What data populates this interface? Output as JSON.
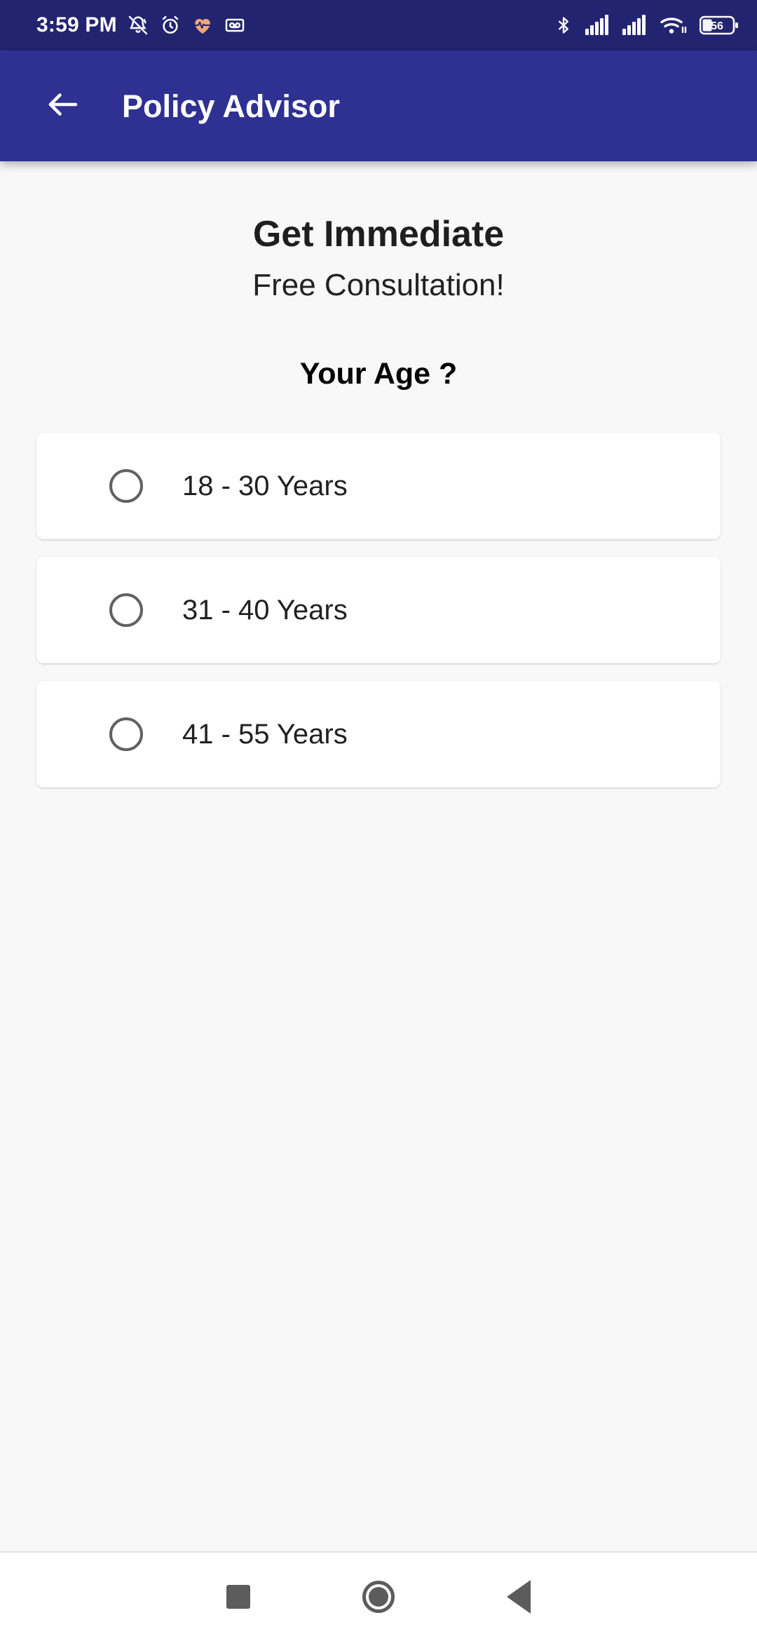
{
  "status_bar": {
    "time": "3:59 PM",
    "battery_level": "56",
    "left_icons": [
      {
        "name": "bell-off-icon"
      },
      {
        "name": "alarm-clock-icon"
      },
      {
        "name": "heart-pulse-icon"
      },
      {
        "name": "voicemail-icon"
      }
    ],
    "right_icons": [
      {
        "name": "bluetooth-icon"
      },
      {
        "name": "signal-bars-sim1-icon"
      },
      {
        "name": "signal-bars-sim2-icon"
      },
      {
        "name": "wifi-icon"
      },
      {
        "name": "battery-icon"
      }
    ],
    "colors": {
      "background": "#232470",
      "foreground": "#FFFFFF",
      "heart": "#F0A878"
    }
  },
  "app_bar": {
    "title": "Policy Advisor",
    "back_icon": "arrow-left-icon",
    "colors": {
      "background": "#2E3192",
      "foreground": "#FFFFFF"
    }
  },
  "main": {
    "headline": "Get Immediate",
    "subheadline": "Free Consultation!",
    "question": "Your Age ?",
    "options": [
      {
        "label": "18 - 30 Years",
        "selected": false
      },
      {
        "label": "31 - 40 Years",
        "selected": false
      },
      {
        "label": "41 - 55 Years",
        "selected": false
      }
    ],
    "colors": {
      "background": "#F8F8F8",
      "card": "#FFFFFF",
      "text": "#212121",
      "radio": "#616161"
    }
  },
  "nav_bar": {
    "buttons": [
      {
        "name": "recents-button",
        "icon": "square-icon"
      },
      {
        "name": "home-button",
        "icon": "circle-icon"
      },
      {
        "name": "back-button",
        "icon": "triangle-left-icon"
      }
    ],
    "colors": {
      "background": "#FFFFFF",
      "foreground": "#5C5C5C"
    }
  }
}
